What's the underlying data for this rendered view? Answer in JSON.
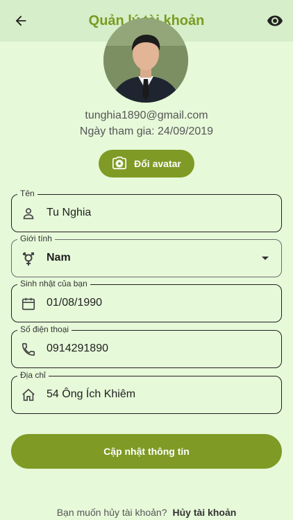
{
  "header": {
    "title": "Quản lý tài khoản"
  },
  "profile": {
    "email": "tunghia1890@gmail.com",
    "joined": "Ngày tham gia: 24/09/2019",
    "change_avatar_label": "Đổi avatar"
  },
  "form": {
    "name": {
      "label": "Tên",
      "value": "Tu Nghia",
      "icon": "person-icon"
    },
    "gender": {
      "label": "Giới tính",
      "value": "Nam",
      "icon": "gender-icon"
    },
    "birthday": {
      "label": "Sinh nhật của bạn",
      "value": "01/08/1990",
      "icon": "calendar-icon"
    },
    "phone": {
      "label": "Số điện thoại",
      "value": "0914291890",
      "icon": "phone-icon"
    },
    "address": {
      "label": "Địa chỉ",
      "value": "54 Ông Ích Khiêm",
      "icon": "home-icon"
    }
  },
  "update_button": "Cập nhật thông tin",
  "footer": {
    "prompt": "Bạn muốn hủy tài khoản?",
    "link": "Hủy tài khoản"
  },
  "colors": {
    "accent": "#7f9a25",
    "title": "#7a9a22",
    "background": "#e6f9d9",
    "appbar": "#d6eec9"
  }
}
